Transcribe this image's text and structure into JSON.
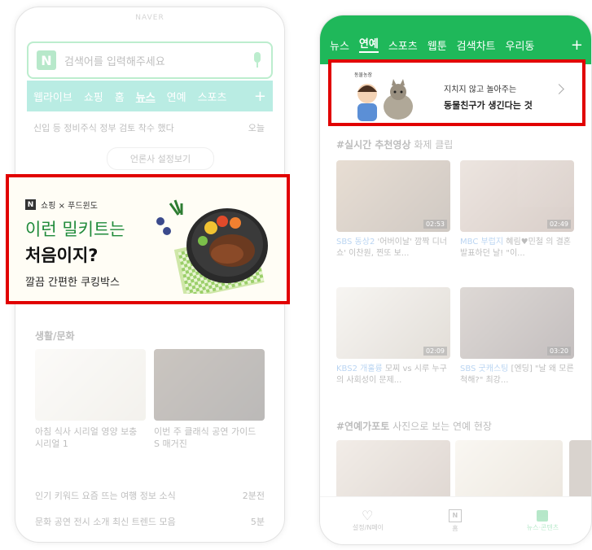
{
  "left": {
    "status": "NAVER",
    "search_text": "검색어를 입력해주세요",
    "tabs": [
      {
        "label": "웹라이브"
      },
      {
        "label": "쇼핑"
      },
      {
        "label": "홈"
      },
      {
        "label": "뉴스"
      },
      {
        "label": "연예"
      },
      {
        "label": "스포츠"
      }
    ],
    "plus": "+",
    "headline1": "신입 등 정비주식 정부 검토 착수 했다",
    "headline1_source": "오늘",
    "more_label": "언론사 설정보기",
    "ad": {
      "brand": "쇼핑 × 푸드윈도",
      "line1": "이런 밀키트는",
      "line2": "처음이지?",
      "line3": "깔끔 간편한 쿠킹박스"
    },
    "section_title": "생활/문화",
    "tiles": [
      {
        "caption1": "아침 식사 시리얼 영양 보충",
        "caption2": "시리얼 1"
      },
      {
        "caption1": "이번 주 클래식 공연 가이드",
        "caption2": "S 매거진"
      }
    ],
    "rows": [
      {
        "text": "인기 키워드 요즘 뜨는 여행 정보 소식",
        "meta": "2분전"
      },
      {
        "text": "문화 공연 전시 소개 최신 트렌드 모음",
        "meta": "5분"
      }
    ]
  },
  "right": {
    "tabs": [
      {
        "label": "뉴스"
      },
      {
        "label": "연예"
      },
      {
        "label": "스포츠"
      },
      {
        "label": "웹툰"
      },
      {
        "label": "검색차트"
      },
      {
        "label": "우리동"
      }
    ],
    "plus": "+",
    "ad": {
      "tag": "동물농장",
      "text1": "지치지 않고 놀아주는",
      "text2": "동물친구가 생긴다는 것"
    },
    "section1": {
      "bold": "#실시간 추천영상",
      "rest": "화제 클립"
    },
    "videos": [
      {
        "duration": "02:53",
        "src": "SBS 동상2",
        "title": "'어버이날' 깜짝 디너쇼' 이찬원, 찐또 보..."
      },
      {
        "duration": "02:49",
        "src": "MBC 부럽지",
        "title": "혜림♥민철 의 결혼 발표하던 날! \"이..."
      },
      {
        "duration": "02:09",
        "src": "KBS2 개훌륭",
        "title": "모찌 vs 시루 누구의 사회성이 문제..."
      },
      {
        "duration": "03:20",
        "src": "SBS 굿캐스팅",
        "title": "[엔딩] \"날 왜 모른척해?\" 최강..."
      }
    ],
    "section2": {
      "bold": "#연예가포토",
      "rest": "사진으로 보는 연예 현장"
    },
    "nav": [
      {
        "label": "설정/N페이"
      },
      {
        "label": "홈"
      },
      {
        "label": "뉴스·콘텐츠"
      }
    ]
  }
}
